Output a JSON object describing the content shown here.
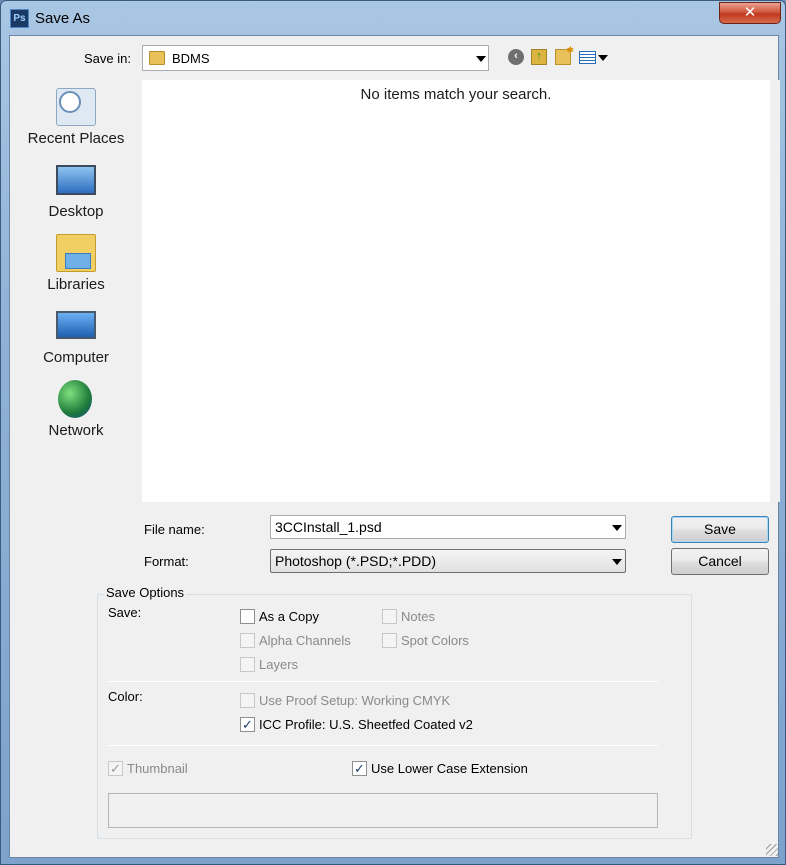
{
  "window": {
    "title": "Save As",
    "app_icon_text": "Ps",
    "close_glyph": "✕"
  },
  "toolbar": {
    "save_in_label": "Save in:",
    "save_in_value": "BDMS"
  },
  "places": [
    {
      "label": "Recent Places",
      "icon": "recent-places-icon"
    },
    {
      "label": "Desktop",
      "icon": "desktop-icon"
    },
    {
      "label": "Libraries",
      "icon": "libraries-icon"
    },
    {
      "label": "Computer",
      "icon": "computer-icon"
    },
    {
      "label": "Network",
      "icon": "network-icon"
    }
  ],
  "file_list": {
    "empty_message": "No items match your search."
  },
  "form": {
    "file_name_label": "File name:",
    "file_name_value": "3CCInstall_1.psd",
    "format_label": "Format:",
    "format_value": "Photoshop (*.PSD;*.PDD)"
  },
  "buttons": {
    "save": "Save",
    "cancel": "Cancel"
  },
  "save_options": {
    "title": "Save Options",
    "save_label": "Save:",
    "as_a_copy": "As a Copy",
    "notes": "Notes",
    "alpha_channels": "Alpha Channels",
    "spot_colors": "Spot Colors",
    "layers": "Layers",
    "color_label": "Color:",
    "use_proof_setup": "Use Proof Setup:  Working CMYK",
    "icc_profile": "ICC Profile:  U.S. Sheetfed Coated v2",
    "thumbnail": "Thumbnail",
    "lower_case_ext": "Use Lower Case Extension",
    "check_glyph": "✓"
  },
  "state": {
    "as_a_copy": false,
    "notes": false,
    "alpha_channels": false,
    "spot_colors": false,
    "layers": false,
    "use_proof_setup": false,
    "icc_profile": true,
    "thumbnail": true,
    "lower_case_ext": true
  },
  "colors": {
    "title_bar": "#a9c6e3",
    "client": "#f0f0f0",
    "close_button": "#c0391f",
    "default_button_border": "#3c7fb1"
  }
}
